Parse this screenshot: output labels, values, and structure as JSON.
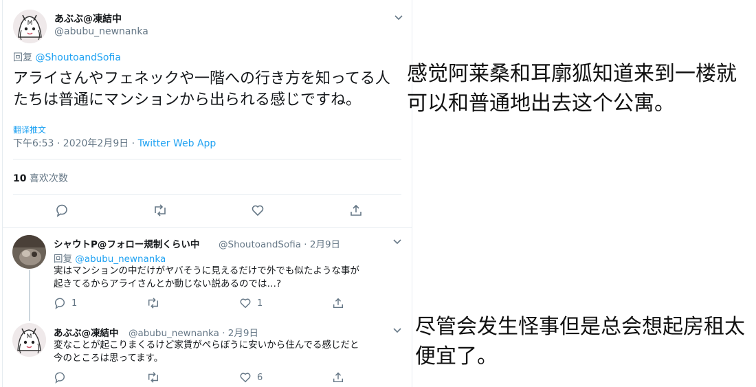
{
  "main_tweet": {
    "display_name": "あぶぶ@凍結中",
    "handle": "@abubu_newnanka",
    "reply_prefix": "回复",
    "reply_to": "@ShoutoandSofia",
    "text": "アライさんやフェネックや一階への行き方を知ってる人たちは普通にマンションから出られる感じですね。",
    "translate": "翻译推文",
    "time": "下午6:53 · 2020年2月9日 · ",
    "source": "Twitter Web App",
    "likes_count": "10",
    "likes_label": " 喜欢次数"
  },
  "reply1": {
    "display_name": "シャウトP@フォロー規制くらい中",
    "handle_time": "@ShoutoandSofia · 2月9日",
    "reply_prefix": "回复",
    "reply_to": "@abubu_newnanka",
    "text_line1": "実はマンションの中だけがヤバそうに見えるだけで外でも似たような事が",
    "text_line2": "起きてるからアライさんとか動じない説あるのでは…?",
    "reply_count": "1",
    "retweet_count": "",
    "like_count": "1"
  },
  "reply2": {
    "display_name": "あぶぶ@凍結中",
    "handle_time": "@abubu_newnanka · 2月9日",
    "text_line1": "変なことが起こりまくるけど家賃がぺらぼうに安いから住んでる感じだと",
    "text_line2": "今のところは思ってます。",
    "reply_count": "",
    "retweet_count": "",
    "like_count": "6"
  },
  "annotations": {
    "top": "感觉阿莱桑和耳廓狐知道来到一楼就可以和普通地出去这个公寓。",
    "bottom": "尽管会发生怪事但是总会想起房租太便宜了。"
  },
  "colors": {
    "accent": "#1da1f2",
    "muted": "#657786",
    "border": "#e6ecf0"
  }
}
